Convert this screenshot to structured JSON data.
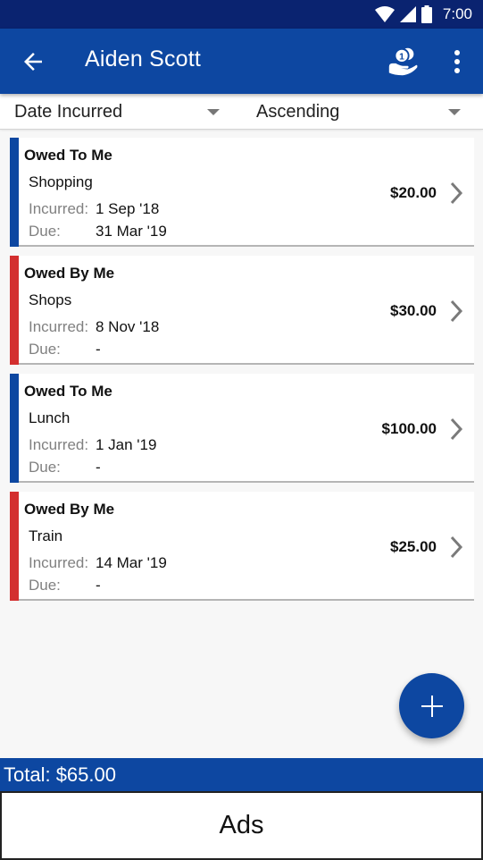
{
  "status_bar": {
    "time": "7:00",
    "icons": [
      "wifi-icon",
      "cell-signal-icon",
      "battery-icon"
    ]
  },
  "app_bar": {
    "title": "Aiden Scott",
    "back_icon": "arrow-left-icon",
    "settle_icon": "hand-coin-icon",
    "more_icon": "more-vertical-icon"
  },
  "sort": {
    "field": "Date Incurred",
    "order": "Ascending"
  },
  "colors": {
    "primary": "#0d47a1",
    "status_bar": "#0a2370",
    "owed_to_me": "#0d47a1",
    "owed_by_me": "#d32f2f"
  },
  "labels": {
    "incurred": "Incurred:",
    "due": "Due:"
  },
  "debts": [
    {
      "type": "Owed To Me",
      "direction": "to_me",
      "description": "Shopping",
      "incurred": "1 Sep '18",
      "due": "31 Mar '19",
      "amount": "$20.00"
    },
    {
      "type": "Owed By Me",
      "direction": "by_me",
      "description": "Shops",
      "incurred": "8 Nov '18",
      "due": "-",
      "amount": "$30.00"
    },
    {
      "type": "Owed To Me",
      "direction": "to_me",
      "description": "Lunch",
      "incurred": "1 Jan '19",
      "due": "-",
      "amount": "$100.00"
    },
    {
      "type": "Owed By Me",
      "direction": "by_me",
      "description": "Train",
      "incurred": "14 Mar '19",
      "due": "-",
      "amount": "$25.00"
    }
  ],
  "fab": {
    "icon": "plus-icon"
  },
  "total": "Total: $65.00",
  "ads": "Ads"
}
